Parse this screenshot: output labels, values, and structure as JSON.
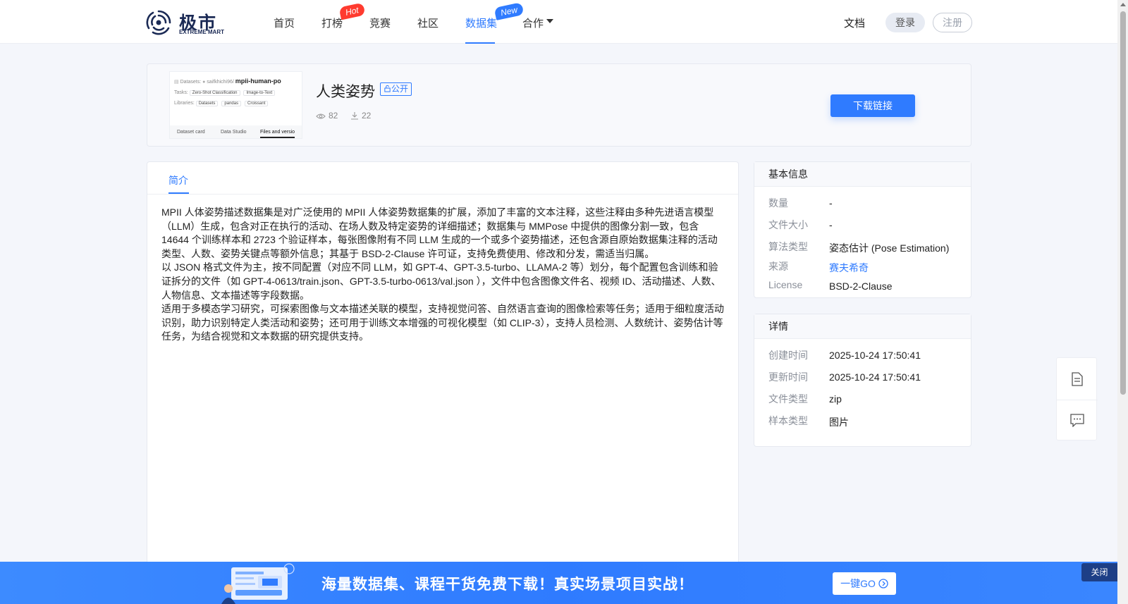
{
  "header": {
    "logo_cn": "极市",
    "logo_en": "EXTREME MART",
    "nav": [
      {
        "label": "首页"
      },
      {
        "label": "打榜",
        "badge": "Hot"
      },
      {
        "label": "竞赛"
      },
      {
        "label": "社区"
      },
      {
        "label": "数据集",
        "badge": "New",
        "active": true
      },
      {
        "label": "合作"
      }
    ],
    "docs": "文档",
    "login": "登录",
    "register": "注册"
  },
  "dataset": {
    "title": "人类姿势",
    "visibility": "公开",
    "views": "82",
    "downloads": "22",
    "download_button": "下载链接",
    "thumbnail": {
      "crumb": "Datasets:",
      "user": "saifkhichi96",
      "name": "mpii-human-po",
      "tasks_label": "Tasks:",
      "tasks": [
        "Zero-Shot Classification",
        "Image-to-Text"
      ],
      "libraries_label": "Libraries:",
      "libraries": [
        "Datasets",
        "pandas",
        "Croissant"
      ],
      "tabs": [
        "Dataset card",
        "Data Studio",
        "Files and versio"
      ]
    }
  },
  "intro": {
    "tab": "简介",
    "paragraphs": [
      "MPII 人体姿势描述数据集是对广泛使用的 MPII 人体姿势数据集的扩展，添加了丰富的文本注释，这些注释由多种先进语言模型（LLM）生成，包含对正在执行的活动、在场人数及特定姿势的详细描述；数据集与 MMPose 中提供的图像分割一致，包含 14644 个训练样本和 2723 个验证样本，每张图像附有不同 LLM 生成的一个或多个姿势描述，还包含源自原始数据集注释的活动类型、人数、姿势关键点等额外信息；其基于 BSD-2-Clause 许可证，支持免费使用、修改和分发，需适当归属。",
      "以 JSON 格式文件为主，按不同配置（对应不同 LLM，如 GPT-4、GPT-3.5-turbo、LLAMA-2 等）划分，每个配置包含训练和验证拆分的文件（如 GPT-4-0613/train.json、GPT-3.5-turbo-0613/val.json ），文件中包含图像文件名、视频 ID、活动描述、人数、人物信息、文本描述等字段数据。",
      "适用于多模态学习研究，可探索图像与文本描述关联的模型，支持视觉问答、自然语言查询的图像检索等任务；适用于细粒度活动识别，助力识别特定人类活动和姿势；还可用于训练文本增强的可视化模型（如 CLIP-3），支持人员检测、人数统计、姿势估计等任务，为结合视觉和文本数据的研究提供支持。"
    ]
  },
  "basic_info": {
    "title": "基本信息",
    "rows": [
      {
        "key": "数量",
        "value": "-"
      },
      {
        "key": "文件大小",
        "value": "-"
      },
      {
        "key": "算法类型",
        "value": "姿态估计 (Pose Estimation)"
      },
      {
        "key": "来源",
        "value": "赛夫希奇"
      },
      {
        "key": "License",
        "value": "BSD-2-Clause"
      }
    ]
  },
  "details": {
    "title": "详情",
    "rows": [
      {
        "key": "创建时间",
        "value": "2025-10-24 17:50:41"
      },
      {
        "key": "更新时间",
        "value": "2025-10-24 17:50:41"
      },
      {
        "key": "文件类型",
        "value": "zip"
      },
      {
        "key": "样本类型",
        "value": "图片"
      }
    ]
  },
  "dock": {
    "icons": [
      "document-icon",
      "feedback-icon"
    ]
  },
  "promo": {
    "text": "海量数据集、课程干货免费下载！真实场景项目实战！",
    "go_button": "一键GO",
    "close": "关闭"
  },
  "colors": {
    "accent": "#2f7bff",
    "hot": "#ff3b2f",
    "brand_dark": "#1b2a55",
    "promo": "#2f7bff"
  }
}
